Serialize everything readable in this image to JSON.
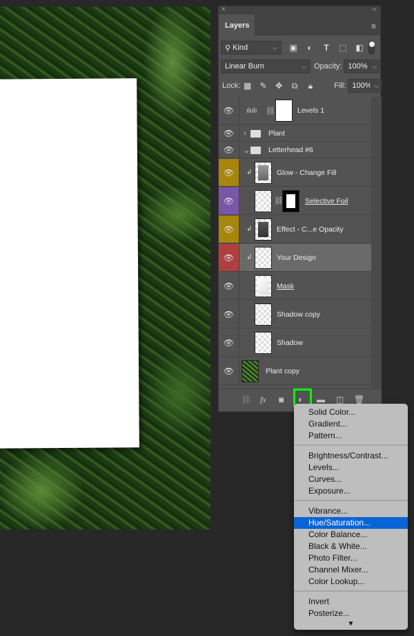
{
  "panel": {
    "title": "Layers",
    "close": "×",
    "collapse": "‹‹",
    "menu": "≡",
    "filter": {
      "value": "Kind"
    },
    "blend": {
      "value": "Linear Burn",
      "opacity_label": "Opacity:",
      "opacity": "100%"
    },
    "lock": {
      "label": "Lock:",
      "fill_label": "Fill:",
      "fill": "100%"
    },
    "layers": [
      {
        "name": "Levels 1",
        "color": "#535353"
      },
      {
        "name": "Plant",
        "color": "#535353"
      },
      {
        "name": "Letterhead #6",
        "color": "#535353"
      },
      {
        "name": "Glow - Change Fill",
        "color": "#a8860c"
      },
      {
        "name": "Selective Foil",
        "color": "#7a55a8"
      },
      {
        "name": "Effect - C...e Opacity",
        "color": "#a8860c"
      },
      {
        "name": "Your Design",
        "color": "#b04040",
        "selected": true
      },
      {
        "name": "Mask",
        "color": "#535353"
      },
      {
        "name": "Shadow copy",
        "color": "#535353"
      },
      {
        "name": "Shadow",
        "color": "#535353"
      },
      {
        "name": "Plant copy",
        "color": "#535353"
      }
    ]
  },
  "menu": {
    "groups": [
      [
        "Solid Color...",
        "Gradient...",
        "Pattern..."
      ],
      [
        "Brightness/Contrast...",
        "Levels...",
        "Curves...",
        "Exposure..."
      ],
      [
        "Vibrance...",
        "Hue/Saturation...",
        "Color Balance...",
        "Black & White...",
        "Photo Filter...",
        "Channel Mixer...",
        "Color Lookup..."
      ],
      [
        "Invert",
        "Posterize..."
      ]
    ],
    "highlighted": "Hue/Saturation...",
    "more": "▼"
  },
  "highlight_color": "#00ff00"
}
